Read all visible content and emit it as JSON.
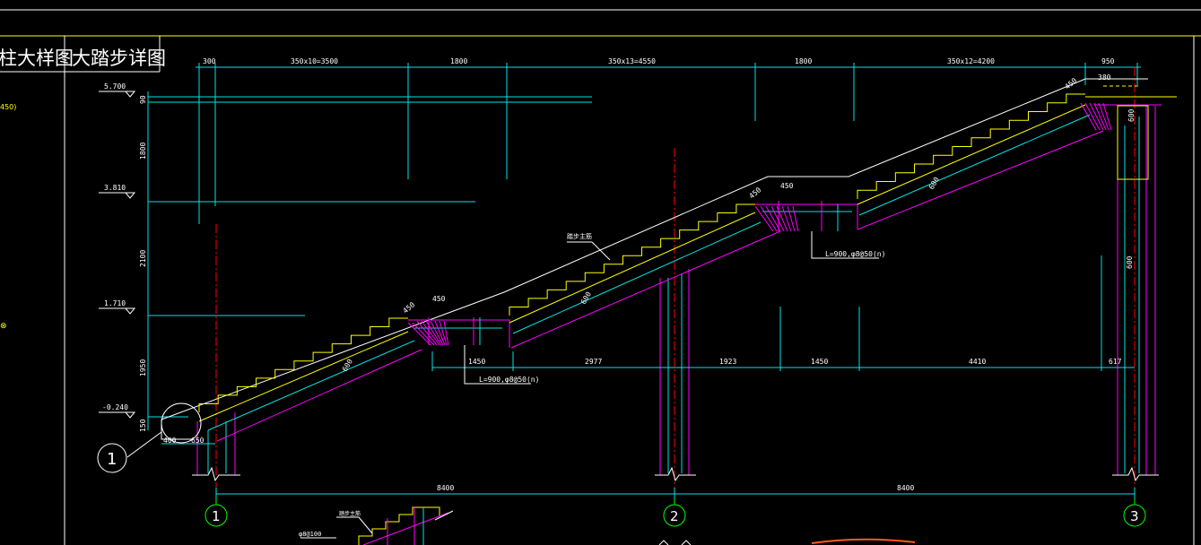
{
  "drawing": {
    "title_left": "柱大样图",
    "title_main": "大踏步详图",
    "left_note_1": "450)",
    "left_note_2": "⊗"
  },
  "dimensions_top": {
    "d1": "300",
    "d2": "350x10=3500",
    "d3": "1800",
    "d4": "350x13=4550",
    "d5": "1800",
    "d6": "350x12=4200",
    "d7": "950",
    "d8": "380"
  },
  "levels": {
    "l1": "5.700",
    "l2": "3.810",
    "l3": "1.710",
    "l4": "-0.240"
  },
  "vertical_dims": {
    "v1": "90",
    "v2": "1800",
    "v3": "2100",
    "v4": "1950",
    "v5": "150"
  },
  "slab_dims": {
    "s1": "450",
    "s2": "450",
    "s3": "450",
    "s4": "450",
    "s5": "450",
    "s6": "600",
    "s7": "600",
    "s8": "600",
    "s9": "600",
    "s10": "600"
  },
  "bottom_dims": {
    "b1": "400",
    "b2": "650",
    "b3": "1450",
    "b4": "2977",
    "b5": "1923",
    "b6": "1450",
    "b7": "4410",
    "b8": "617"
  },
  "spans": {
    "span1": "8400",
    "span2": "8400"
  },
  "annotations": {
    "rebar1": "L=900,φ8@50(n)",
    "rebar2": "L=900,φ8@50(n)",
    "note_mid": "踏步主筋",
    "note_bottom1": "φ8@100",
    "note_bottom2": "踏步主筋"
  },
  "axes": {
    "a1": "1",
    "a2": "2",
    "a3": "3",
    "detail": "1"
  },
  "colors": {
    "bg": "#000000",
    "cyan": "#00e5e5",
    "magenta": "#ff00ff",
    "yellow": "#ffff00",
    "white": "#ffffff",
    "red": "#ff0000",
    "green": "#00ff00",
    "orange": "#ff5a1a"
  }
}
